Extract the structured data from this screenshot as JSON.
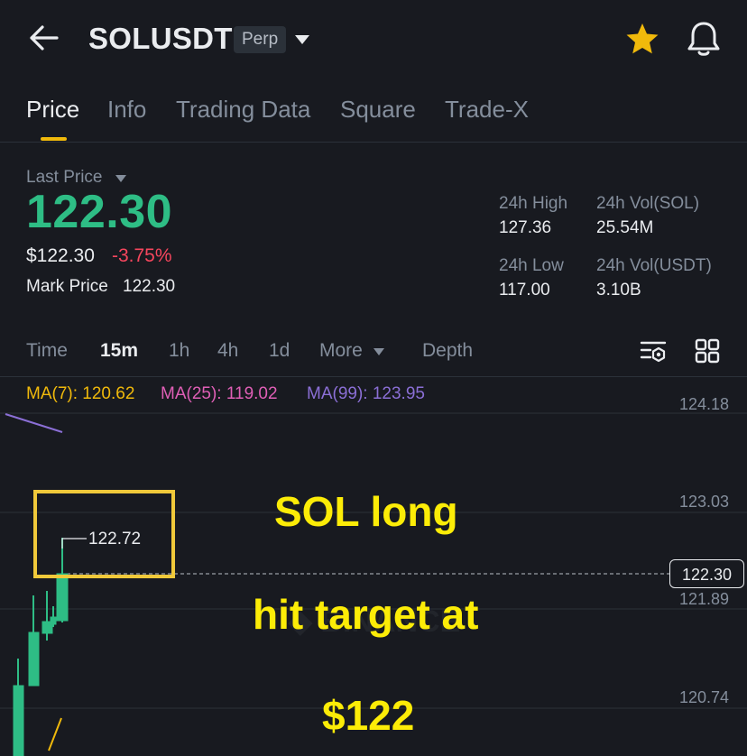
{
  "header": {
    "symbol": "SOLUSDT",
    "badge": "Perp",
    "icons": [
      "back-arrow-icon",
      "dropdown-caret-icon",
      "star-icon",
      "bell-icon"
    ]
  },
  "tabs": [
    {
      "label": "Price",
      "active": true
    },
    {
      "label": "Info"
    },
    {
      "label": "Trading Data"
    },
    {
      "label": "Square"
    },
    {
      "label": "Trade-X"
    }
  ],
  "price": {
    "last_price_label": "Last Price",
    "last_price": "122.30",
    "usd_price": "$122.30",
    "change_pct": "-3.75%",
    "mark_price_label": "Mark Price",
    "mark_price": "122.30"
  },
  "stats": {
    "high_label": "24h High",
    "high_value": "127.36",
    "vol_sol_label": "24h Vol(SOL)",
    "vol_sol_value": "25.54M",
    "low_label": "24h Low",
    "low_value": "117.00",
    "vol_usdt_label": "24h Vol(USDT)",
    "vol_usdt_value": "3.10B"
  },
  "intervals": {
    "time": "Time",
    "m15": "15m",
    "h1": "1h",
    "h4": "4h",
    "d1": "1d",
    "more": "More",
    "depth": "Depth",
    "active": "15m"
  },
  "ma": {
    "ma7": "MA(7): 120.62",
    "ma25": "MA(25): 119.02",
    "ma99": "MA(99): 123.95"
  },
  "chart": {
    "price_axis": [
      "124.18",
      "123.03",
      "121.89",
      "120.74"
    ],
    "current_price": "122.30",
    "high_marker": "122.72"
  },
  "annotation": {
    "line1": "SOL long",
    "line2": "hit target at",
    "line3": "$122"
  },
  "colors": {
    "up": "#2ebd85",
    "down": "#f6465d",
    "accent": "#f0b90b",
    "ma7": "#f0b90b",
    "ma25": "#e05fb6",
    "ma99": "#8b6fd6",
    "annotation": "#fcec07"
  }
}
